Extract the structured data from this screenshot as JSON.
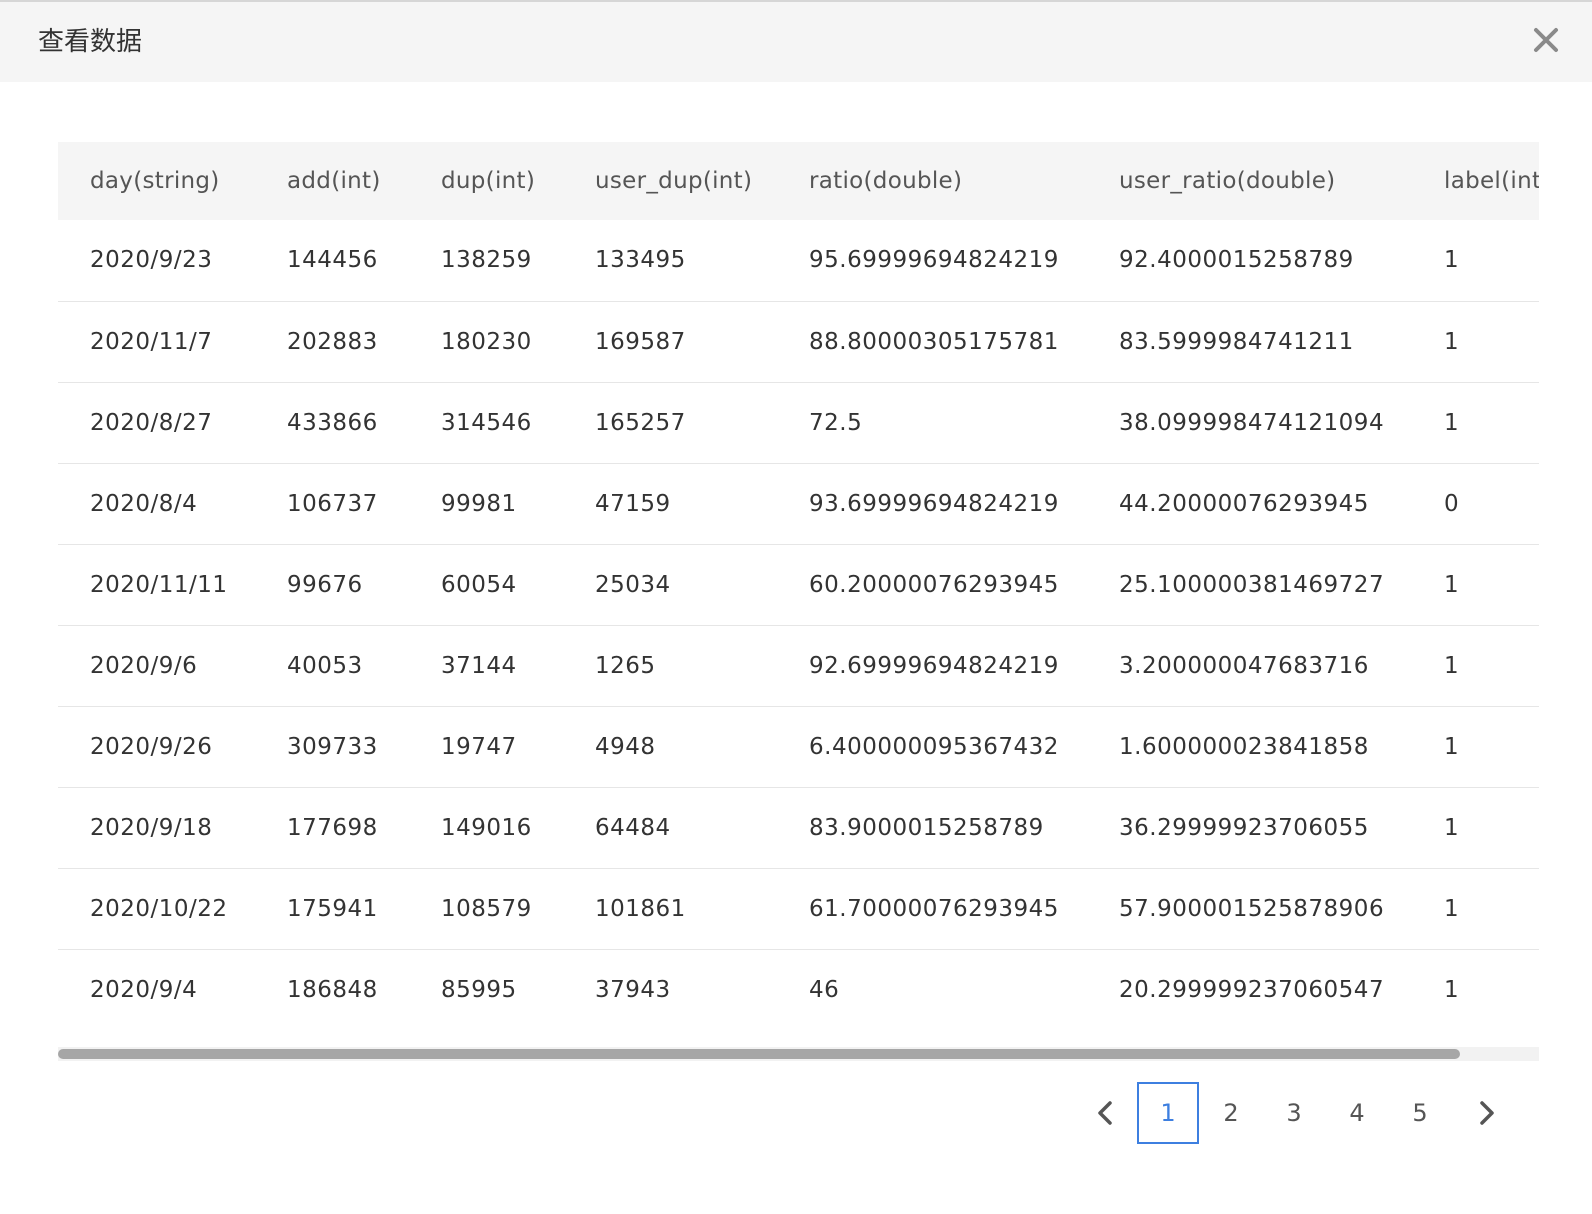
{
  "dialog": {
    "title": "查看数据",
    "close_label": "×"
  },
  "table": {
    "columns": [
      "day(string)",
      "add(int)",
      "dup(int)",
      "user_dup(int)",
      "ratio(double)",
      "user_ratio(double)",
      "label(int)"
    ],
    "rows": [
      [
        "2020/9/23",
        "144456",
        "138259",
        "133495",
        "95.69999694824219",
        "92.4000015258789",
        "1"
      ],
      [
        "2020/11/7",
        "202883",
        "180230",
        "169587",
        "88.80000305175781",
        "83.5999984741211",
        "1"
      ],
      [
        "2020/8/27",
        "433866",
        "314546",
        "165257",
        "72.5",
        "38.099998474121094",
        "1"
      ],
      [
        "2020/8/4",
        "106737",
        "99981",
        "47159",
        "93.69999694824219",
        "44.20000076293945",
        "0"
      ],
      [
        "2020/11/11",
        "99676",
        "60054",
        "25034",
        "60.20000076293945",
        "25.100000381469727",
        "1"
      ],
      [
        "2020/9/6",
        "40053",
        "37144",
        "1265",
        "92.69999694824219",
        "3.200000047683716",
        "1"
      ],
      [
        "2020/9/26",
        "309733",
        "19747",
        "4948",
        "6.400000095367432",
        "1.600000023841858",
        "1"
      ],
      [
        "2020/9/18",
        "177698",
        "149016",
        "64484",
        "83.9000015258789",
        "36.29999923706055",
        "1"
      ],
      [
        "2020/10/22",
        "175941",
        "108579",
        "101861",
        "61.70000076293945",
        "57.900001525878906",
        "1"
      ],
      [
        "2020/9/4",
        "186848",
        "85995",
        "37943",
        "46",
        "20.299999237060547",
        "1"
      ]
    ]
  },
  "pagination": {
    "pages": [
      "1",
      "2",
      "3",
      "4",
      "5"
    ],
    "current": "1"
  },
  "colors": {
    "accent": "#3d7fe0",
    "header_bg": "#f5f5f5"
  },
  "icons": {
    "close": "close-icon",
    "prev": "chevron-left-icon",
    "next": "chevron-right-icon"
  }
}
